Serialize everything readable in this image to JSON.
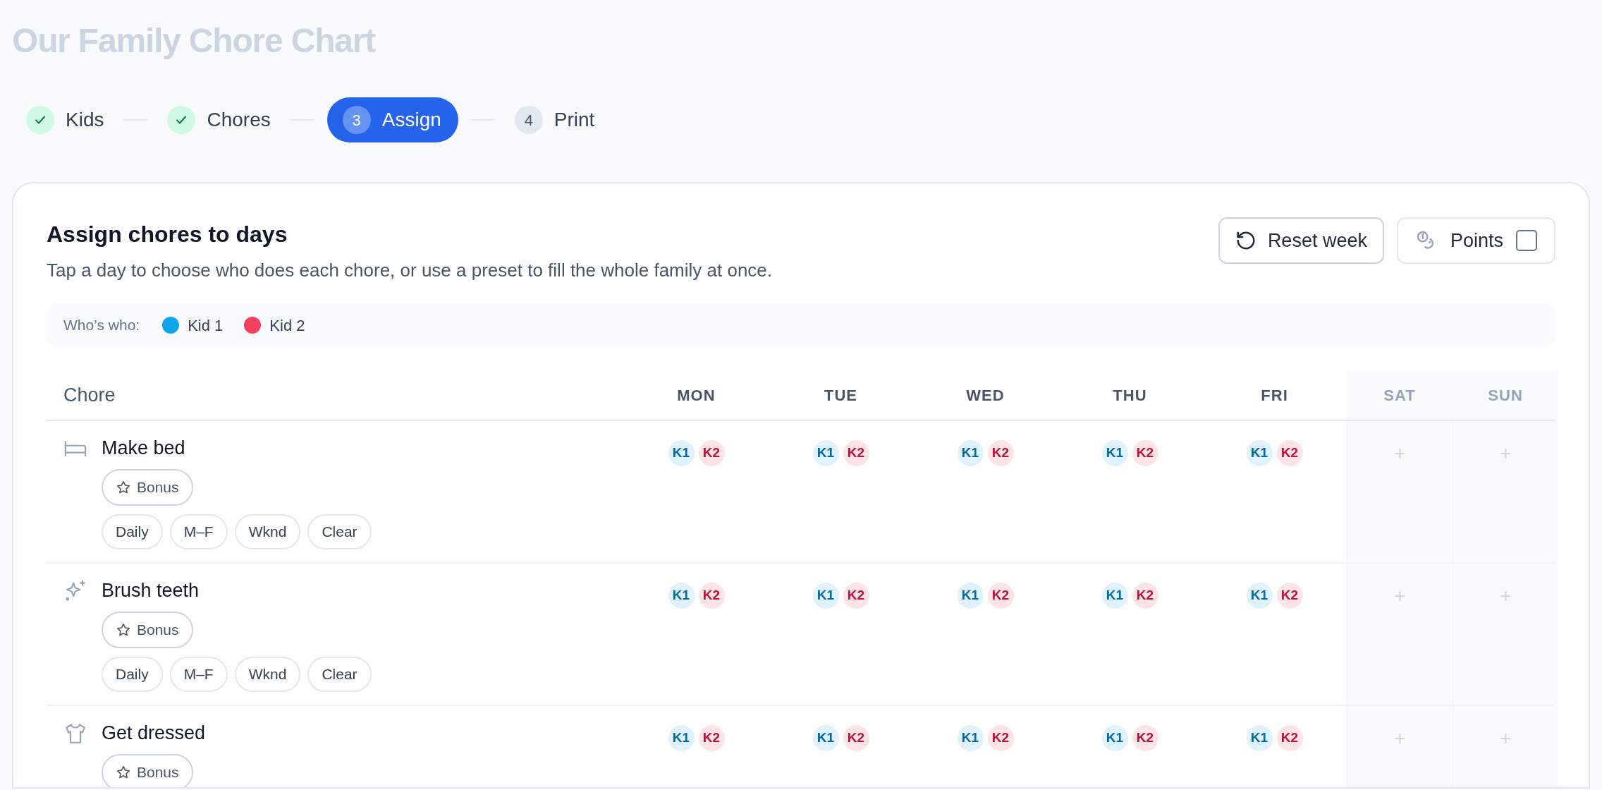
{
  "page_title": "Our Family Chore Chart",
  "steps": [
    {
      "label": "Kids",
      "done": true,
      "selected": false
    },
    {
      "label": "Chores",
      "done": true,
      "selected": false
    },
    {
      "number": "3",
      "label": "Assign",
      "done": false,
      "selected": true
    },
    {
      "number": "4",
      "label": "Print",
      "done": false,
      "selected": false
    }
  ],
  "card": {
    "title": "Assign chores to days",
    "subtitle": "Tap a day to choose who does each chore, or use a preset to fill the whole family at once.",
    "buttons": [
      {
        "kind": "reset",
        "label": "Reset week"
      },
      {
        "kind": "points",
        "label": "Points",
        "checked": false
      }
    ]
  },
  "legend": {
    "label": "Who’s who:",
    "kids": [
      {
        "name": "Kid 1",
        "color": "#0ea5e9"
      },
      {
        "name": "Kid 2",
        "color": "#f43f5e"
      }
    ]
  },
  "table": {
    "chore_header": "Chore",
    "days": [
      {
        "label": "MON",
        "weekend": false
      },
      {
        "label": "TUE",
        "weekend": false
      },
      {
        "label": "WED",
        "weekend": false
      },
      {
        "label": "THU",
        "weekend": false
      },
      {
        "label": "FRI",
        "weekend": false
      },
      {
        "label": "SAT",
        "weekend": true
      },
      {
        "label": "SUN",
        "weekend": true
      }
    ],
    "rows": [
      {
        "kind": "bed",
        "name": "Make bed",
        "bonus": "Bonus",
        "presets": [
          "Daily",
          "M–F",
          "Wknd",
          "Clear"
        ],
        "cells": [
          {
            "chips": [
              "K1",
              "K2"
            ]
          },
          {
            "chips": [
              "K1",
              "K2"
            ]
          },
          {
            "chips": [
              "K1",
              "K2"
            ]
          },
          {
            "chips": [
              "K1",
              "K2"
            ]
          },
          {
            "chips": [
              "K1",
              "K2"
            ]
          },
          {
            "add": "+"
          },
          {
            "add": "+"
          }
        ]
      },
      {
        "kind": "sparkle",
        "name": "Brush teeth",
        "bonus": "Bonus",
        "presets": [
          "Daily",
          "M–F",
          "Wknd",
          "Clear"
        ],
        "cells": [
          {
            "chips": [
              "K1",
              "K2"
            ]
          },
          {
            "chips": [
              "K1",
              "K2"
            ]
          },
          {
            "chips": [
              "K1",
              "K2"
            ]
          },
          {
            "chips": [
              "K1",
              "K2"
            ]
          },
          {
            "chips": [
              "K1",
              "K2"
            ]
          },
          {
            "add": "+"
          },
          {
            "add": "+"
          }
        ]
      },
      {
        "kind": "shirt",
        "name": "Get dressed",
        "bonus": "Bonus",
        "cells": [
          {
            "chips": [
              "K1",
              "K2"
            ]
          },
          {
            "chips": [
              "K1",
              "K2"
            ]
          },
          {
            "chips": [
              "K1",
              "K2"
            ]
          },
          {
            "chips": [
              "K1",
              "K2"
            ]
          },
          {
            "chips": [
              "K1",
              "K2"
            ]
          },
          {
            "add": "+"
          },
          {
            "add": "+"
          }
        ]
      }
    ]
  }
}
